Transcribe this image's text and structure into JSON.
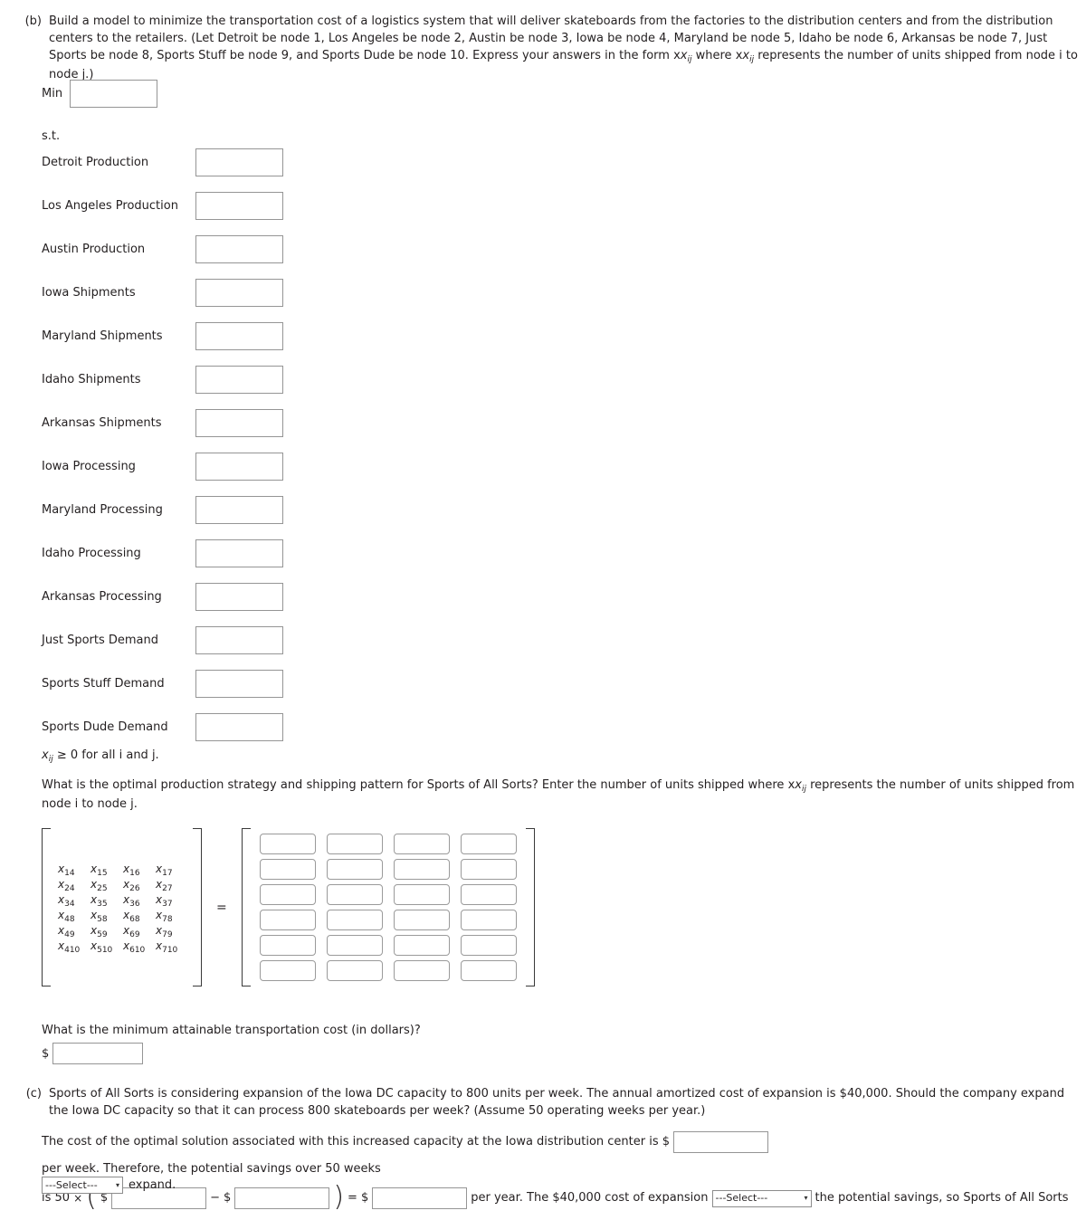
{
  "part_b": {
    "label": "(b)",
    "text": "Build a model to minimize the transportation cost of a logistics system that will deliver skateboards from the factories to the distribution centers and from the distribution centers to the retailers. (Let Detroit be node 1, Los Angeles be node 2, Austin be node 3, Iowa be node 4, Maryland be node 5, Idaho be node 6, Arkansas be node 7, Just Sports be node 8, Sports Stuff be node 9, and Sports Dude be node 10. Express your answers in the form x",
    "text_sub1": "ij",
    "text_mid": " where x",
    "text_sub2": "ij",
    "text_end": " represents the number of units shipped from node i to node j.)"
  },
  "objective": {
    "min_label": "Min",
    "min_value": "",
    "st_label": "s.t."
  },
  "constraints": [
    {
      "name": "Detroit Production",
      "value": ""
    },
    {
      "name": "Los Angeles Production",
      "value": ""
    },
    {
      "name": "Austin Production",
      "value": ""
    },
    {
      "name": "Iowa Shipments",
      "value": ""
    },
    {
      "name": "Maryland Shipments",
      "value": ""
    },
    {
      "name": "Idaho Shipments",
      "value": ""
    },
    {
      "name": "Arkansas Shipments",
      "value": ""
    },
    {
      "name": "Iowa Processing",
      "value": ""
    },
    {
      "name": "Maryland Processing",
      "value": ""
    },
    {
      "name": "Idaho Processing",
      "value": ""
    },
    {
      "name": "Arkansas Processing",
      "value": ""
    },
    {
      "name": "Just Sports Demand",
      "value": ""
    },
    {
      "name": "Sports Stuff Demand",
      "value": ""
    },
    {
      "name": "Sports Dude Demand",
      "value": ""
    }
  ],
  "nonnegativity": {
    "var": "x",
    "sub": "ij",
    "text": " ≥ 0 for all i and j."
  },
  "strategy_question": {
    "text_start": "What is the optimal production strategy and shipping pattern for Sports of All Sorts? Enter the number of units shipped where x",
    "sub": "ij",
    "text_end": " represents the number of units shipped from node i to node j."
  },
  "matrix": {
    "equals": "=",
    "variables": [
      [
        {
          "base": "x",
          "sub": "14"
        },
        {
          "base": "x",
          "sub": "15"
        },
        {
          "base": "x",
          "sub": "16"
        },
        {
          "base": "x",
          "sub": "17"
        }
      ],
      [
        {
          "base": "x",
          "sub": "24"
        },
        {
          "base": "x",
          "sub": "25"
        },
        {
          "base": "x",
          "sub": "26"
        },
        {
          "base": "x",
          "sub": "27"
        }
      ],
      [
        {
          "base": "x",
          "sub": "34"
        },
        {
          "base": "x",
          "sub": "35"
        },
        {
          "base": "x",
          "sub": "36"
        },
        {
          "base": "x",
          "sub": "37"
        }
      ],
      [
        {
          "base": "x",
          "sub": "48"
        },
        {
          "base": "x",
          "sub": "58"
        },
        {
          "base": "x",
          "sub": "68"
        },
        {
          "base": "x",
          "sub": "78"
        }
      ],
      [
        {
          "base": "x",
          "sub": "49"
        },
        {
          "base": "x",
          "sub": "59"
        },
        {
          "base": "x",
          "sub": "69"
        },
        {
          "base": "x",
          "sub": "79"
        }
      ],
      [
        {
          "base": "x",
          "sub": "410"
        },
        {
          "base": "x",
          "sub": "510"
        },
        {
          "base": "x",
          "sub": "610"
        },
        {
          "base": "x",
          "sub": "710"
        }
      ]
    ],
    "answers": [
      [
        "",
        "",
        "",
        ""
      ],
      [
        "",
        "",
        "",
        ""
      ],
      [
        "",
        "",
        "",
        ""
      ],
      [
        "",
        "",
        "",
        ""
      ],
      [
        "",
        "",
        "",
        ""
      ],
      [
        "",
        "",
        "",
        ""
      ]
    ]
  },
  "min_cost": {
    "question": "What is the minimum attainable transportation cost (in dollars)?",
    "dollar": "$",
    "value": ""
  },
  "part_c": {
    "label": "(c)",
    "text": "Sports of All Sorts is considering expansion of the Iowa DC capacity to 800 units per week. The annual amortized cost of expansion is $40,000. Should the company expand the Iowa DC capacity so that it can process 800 skateboards per week? (Assume 50 operating weeks per year.)",
    "line1_start": "The cost of the optimal solution associated with this increased capacity at the Iowa distribution center is $",
    "line1_cost_value": "",
    "line1_end": "per week. Therefore, the potential savings over 50 weeks",
    "line2_is": "is 50",
    "line2_times": "×",
    "line2_dollar1": "$",
    "line2_value1": "",
    "line2_minus": "−",
    "line2_dollar2": "$",
    "line2_value2": "",
    "line2_equals": "=",
    "line2_dollar3": "$",
    "line2_value3": "",
    "line2_peryear": "per year. The $40,000 cost of expansion",
    "select_compare": "---Select---",
    "line2_tail": "the potential savings, so Sports of All Sorts",
    "select_decision": "---Select---",
    "line3_tail": "expand.",
    "caret": "⌄"
  }
}
